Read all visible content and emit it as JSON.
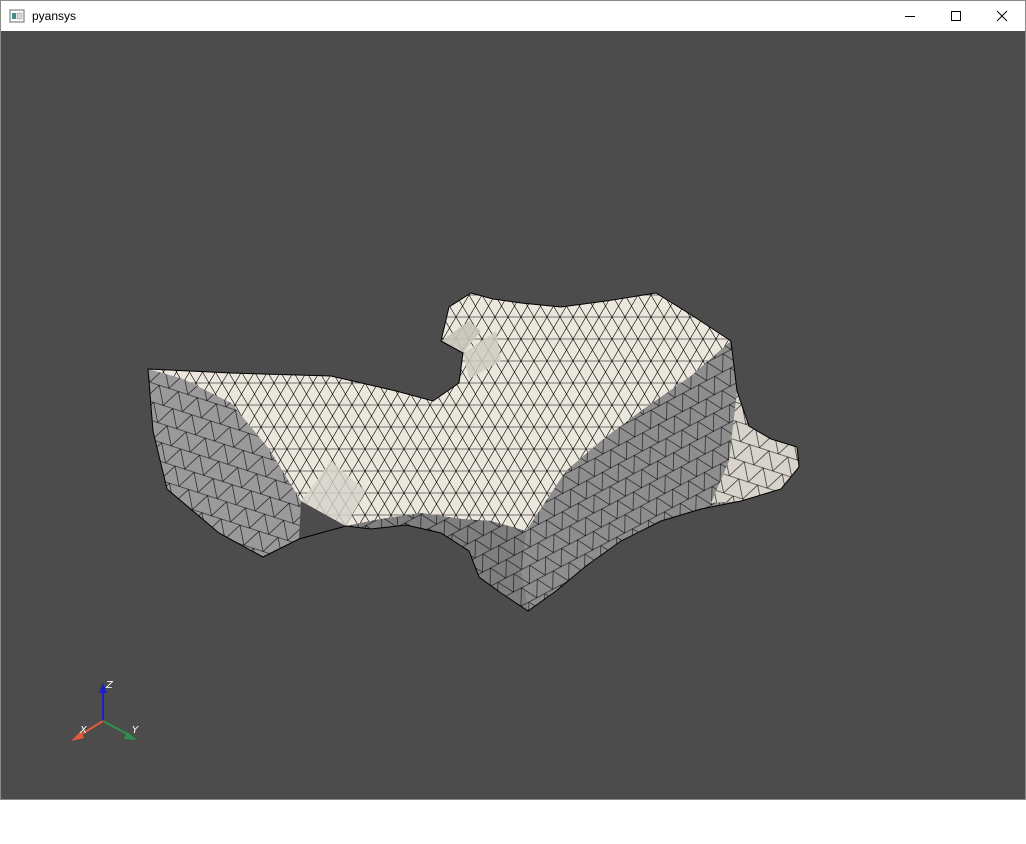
{
  "window": {
    "title": "pyansys",
    "app_icon": "window-app-icon",
    "controls": {
      "minimize": "minimize-icon",
      "maximize": "maximize-icon",
      "close": "close-icon"
    }
  },
  "viewport": {
    "background": "#4c4c4c",
    "mesh_fill_lit": "#ebe7dd",
    "mesh_fill_shadow": "#a9a9a9",
    "mesh_edge": "#000000"
  },
  "axes": {
    "x_label": "X",
    "y_label": "Y",
    "z_label": "Z",
    "x_color": "#e05a3a",
    "y_color": "#2f8f4f",
    "z_color": "#1d1dcc"
  }
}
